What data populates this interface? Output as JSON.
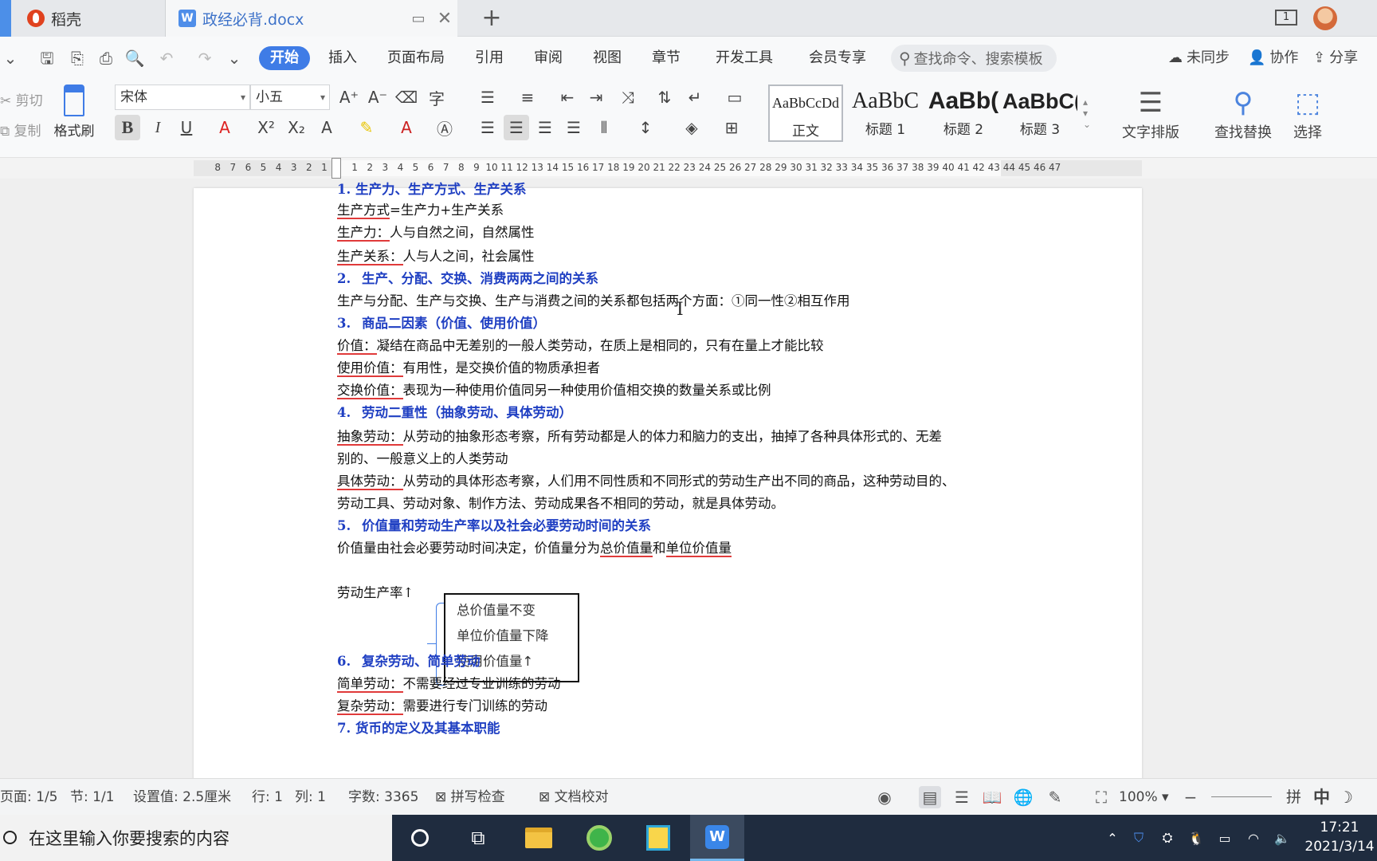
{
  "tabs": {
    "app_label": "稻壳",
    "doc_label": "政经必背.docx"
  },
  "titlebar": {
    "window_count": "1"
  },
  "menu": {
    "items": [
      "开始",
      "插入",
      "页面布局",
      "引用",
      "审阅",
      "视图",
      "章节",
      "开发工具",
      "会员专享"
    ],
    "search_placeholder": "查找命令、搜索模板",
    "unsync": "未同步",
    "collab": "协作",
    "share": "分享"
  },
  "ribbon": {
    "cut": "剪切",
    "copy": "复制",
    "format_painter": "格式刷",
    "font_name": "宋体",
    "font_size": "小五",
    "styles": [
      {
        "preview": "AaBbCcDd",
        "name": "正文"
      },
      {
        "preview": "AaBbC",
        "name": "标题 1"
      },
      {
        "preview": "AaBb(",
        "name": "标题 2"
      },
      {
        "preview": "AaBbC(",
        "name": "标题 3"
      }
    ],
    "text_layout": "文字排版",
    "find_replace": "查找替换",
    "select": "选择"
  },
  "ruler": {
    "left_nums": [
      "8",
      "7",
      "6",
      "5",
      "4",
      "3",
      "2",
      "1"
    ],
    "right_nums": [
      "1",
      "2",
      "3",
      "4",
      "5",
      "6",
      "7",
      "8",
      "9",
      "10",
      "11",
      "12",
      "13",
      "14",
      "15",
      "16",
      "17",
      "18",
      "19",
      "20",
      "21",
      "22",
      "23",
      "24",
      "25",
      "26",
      "27",
      "28",
      "29",
      "30",
      "31",
      "32",
      "33",
      "34",
      "35",
      "36",
      "37",
      "38",
      "39",
      "40",
      "41",
      "42",
      "43",
      "44",
      "45",
      "46",
      "47"
    ]
  },
  "document": {
    "top_partial": "1.  生产力、生产方式、生产关系",
    "l1_term": "生产方式",
    "l1_rest": "=生产力+生产关系",
    "l2_term": "生产力：",
    "l2_rest": "人与自然之间，自然属性",
    "l3_term": "生产关系：",
    "l3_rest": "人与人之间，社会属性",
    "h2_num": "2.",
    "h2_text": "生产、分配、交换、消费两两之间的关系",
    "p2": "生产与分配、生产与交换、生产与消费之间的关系都包括两个方面：①同一性②相互作用",
    "h3_num": "3.",
    "h3_text": "商品二因素（价值、使用价值）",
    "l4_term": "价值：",
    "l4_rest": "凝结在商品中无差别的一般人类劳动，在质上是相同的，只有在量上才能比较",
    "l5_term": "使用价值：",
    "l5_rest": "有用性，是交换价值的物质承担者",
    "l6_term": "交换价值：",
    "l6_rest": "表现为一种使用价值同另一种使用价值相交换的数量关系或比例",
    "h4_num": "4.",
    "h4_text": "劳动二重性（抽象劳动、具体劳动）",
    "l7_term": "抽象劳动：",
    "l7_rest": "从劳动的抽象形态考察，所有劳动都是人的体力和脑力的支出，抽掉了各种具体形式的、无差",
    "l7_cont": "别的、一般意义上的人类劳动",
    "l8_term": "具体劳动：",
    "l8_rest": "从劳动的具体形态考察，人们用不同性质和不同形式的劳动生产出不同的商品，这种劳动目的、",
    "l8_cont": "劳动工具、劳动对象、制作方法、劳动成果各不相同的劳动，就是具体劳动。",
    "h5_num": "5.",
    "h5_text": "价值量和劳动生产率以及社会必要劳动时间的关系",
    "p5_a": "价值量由社会必要劳动时间决定，价值量分为",
    "p5_b": "总价值量",
    "p5_c": "和",
    "p5_d": "单位价值量",
    "diagram_label": "劳动生产率↑",
    "box_lines": [
      "总价值量不变",
      "单位价值量下降",
      "使用价值量↑"
    ],
    "h6_num": "6.",
    "h6_text": "复杂劳动、简单劳动",
    "l9_term": "简单劳动：",
    "l9_rest": "不需要经过专业训练的劳动",
    "l10_term": "复杂劳动：",
    "l10_rest": "需要进行专门训练的劳动",
    "bottom_partial": "7.  货币的定义及其基本职能"
  },
  "status": {
    "page": "页面: 1/5",
    "section": "节: 1/1",
    "setting": "设置值: 2.5厘米",
    "row": "行: 1",
    "col": "列: 1",
    "words": "字数: 3365",
    "spell": "拼写检查",
    "proof": "文档校对",
    "zoom": "100%",
    "ime1": "拼",
    "ime2": "中"
  },
  "taskbar": {
    "search_placeholder": "在这里输入你要搜索的内容",
    "time": "17:21",
    "date": "2021/3/14"
  }
}
